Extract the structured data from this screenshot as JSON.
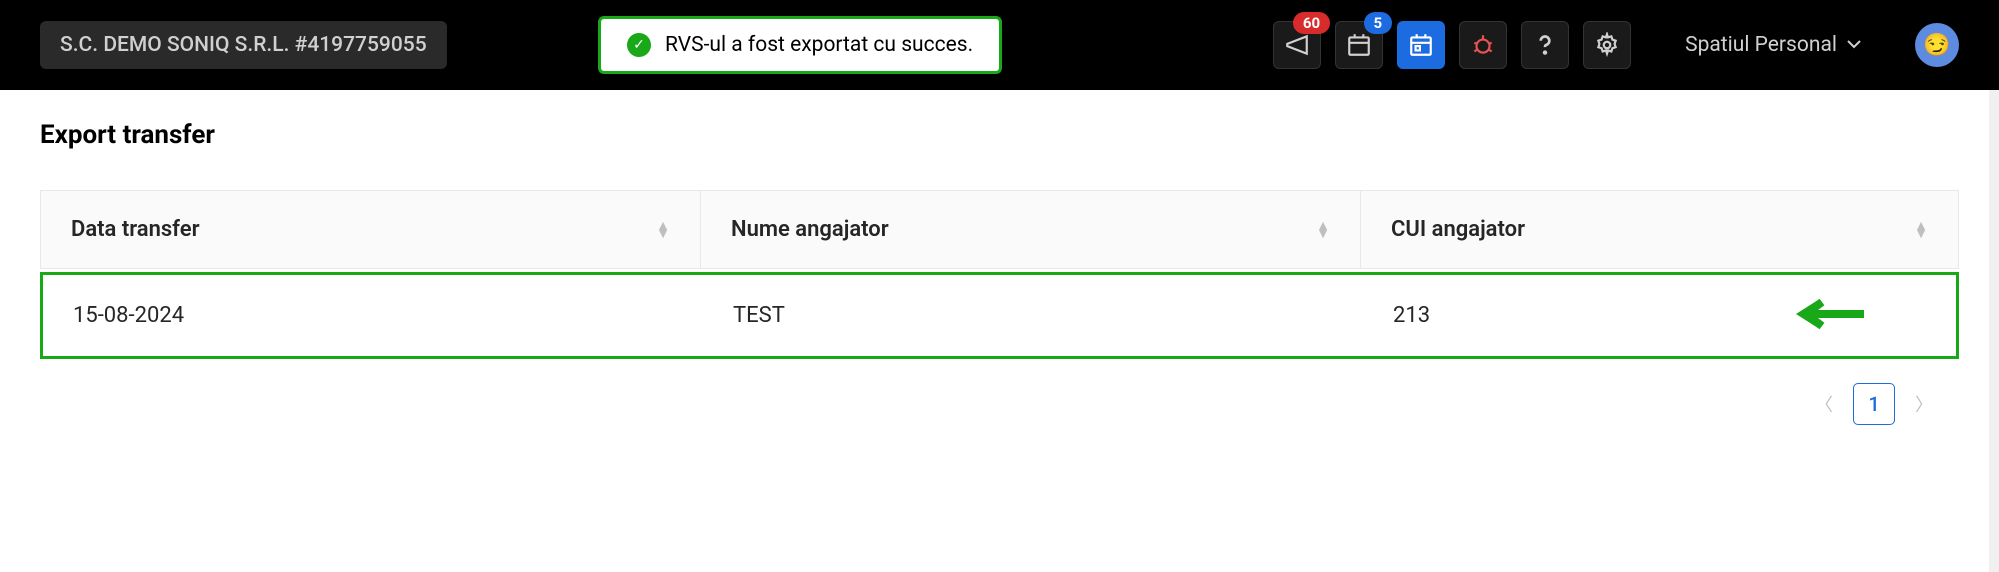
{
  "header": {
    "company": "S.C. DEMO SONIQ S.R.L. #4197759055",
    "toast_message": "RVS-ul a fost exportat cu succes.",
    "badge_announcements": "60",
    "badge_calendar": "5",
    "space_label": "Spatiul Personal"
  },
  "page": {
    "title": "Export transfer"
  },
  "table": {
    "columns": [
      {
        "label": "Data transfer"
      },
      {
        "label": "Nume angajator"
      },
      {
        "label": "CUI angajator"
      }
    ],
    "rows": [
      {
        "date": "15-08-2024",
        "employer_name": "TEST",
        "employer_cui": "213"
      }
    ]
  },
  "pagination": {
    "current_page": "1"
  }
}
